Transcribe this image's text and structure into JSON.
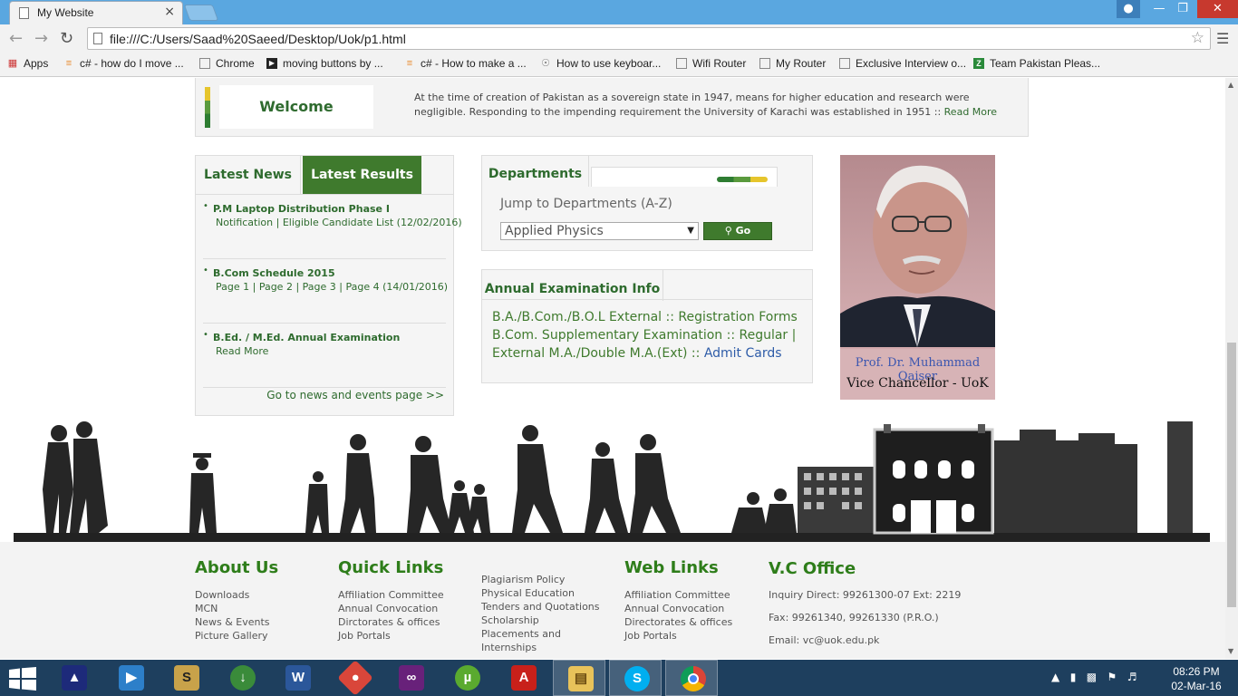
{
  "browser": {
    "tab_title": "My Website",
    "url": "file:///C:/Users/Saad%20Saeed/Desktop/Uok/p1.html",
    "bookmarks": [
      {
        "label": "Apps",
        "icon": "apps-grid-icon"
      },
      {
        "label": "c# - how do I move ...",
        "icon": "stackoverflow-icon"
      },
      {
        "label": "Chrome",
        "icon": "page-icon"
      },
      {
        "label": "moving buttons by ...",
        "icon": "video-icon"
      },
      {
        "label": "c# - How to make a ...",
        "icon": "stackoverflow-icon"
      },
      {
        "label": "How to use keyboar...",
        "icon": "wiki-icon"
      },
      {
        "label": "Wifi Router",
        "icon": "page-icon"
      },
      {
        "label": "My Router",
        "icon": "page-icon"
      },
      {
        "label": "Exclusive Interview o...",
        "icon": "page-icon"
      },
      {
        "label": "Team Pakistan Pleas...",
        "icon": "z-icon"
      }
    ]
  },
  "welcome": {
    "title": "Welcome",
    "text": "At the time of creation of Pakistan as a sovereign state in 1947, means for higher education and research were negligible. Responding to the impending requirement the University of Karachi was established in 1951 :: ",
    "read_more": "Read More"
  },
  "news": {
    "tab_news": "Latest News",
    "tab_results": "Latest Results",
    "items": [
      {
        "title": "P.M Laptop Distribution Phase I",
        "sub": "Notification | Eligible Candidate List (12/02/2016)"
      },
      {
        "title": "B.Com Schedule 2015",
        "sub": "Page 1 | Page 2 | Page 3 | Page 4 (14/01/2016)"
      },
      {
        "title": "B.Ed. / M.Ed. Annual Examination",
        "sub": "Read More"
      }
    ],
    "more": "Go to news and events page >>"
  },
  "departments": {
    "tab": "Departments",
    "label": "Jump to Departments (A-Z)",
    "selected": "Applied Physics",
    "go": "Go"
  },
  "exam": {
    "tab": "Annual Examination Info",
    "line1": "B.A./B.Com./B.O.L External :: Registration Forms",
    "line2": "B.Com. Supplementary Examination :: Regular |",
    "line3_green": "External M.A./Double M.A.(Ext) :: ",
    "line3_blue": "Admit Cards"
  },
  "vc": {
    "name": "Prof. Dr. Muhammad Qaiser",
    "role": "Vice Chancellor - UoK"
  },
  "footer": {
    "about": {
      "title": "About Us",
      "links": [
        "Downloads",
        "MCN",
        "News & Events",
        "Picture Gallery"
      ]
    },
    "quick": {
      "title": "Quick Links",
      "links": [
        "Affiliation Committee",
        "Annual Convocation",
        "Dirctorates & offices",
        "Job Portals"
      ]
    },
    "misc": {
      "links": [
        "Plagiarism Policy",
        "Physical Education",
        "Tenders and Quotations",
        "Scholarship",
        "Placements and",
        "Internships"
      ]
    },
    "web": {
      "title": "Web Links",
      "links": [
        "Affiliation Committee",
        "Annual Convocation",
        "Directorates & offices",
        "Job Portals"
      ]
    },
    "vc_office": {
      "title": "V.C Office",
      "lines": [
        "Inquiry Direct: 99261300-07 Ext: 2219",
        "Fax: 99261340, 99261330 (P.R.O.)",
        "Email: vc@uok.edu.pk"
      ]
    }
  },
  "taskbar": {
    "time": "08:26 PM",
    "date": "02-Mar-16"
  }
}
